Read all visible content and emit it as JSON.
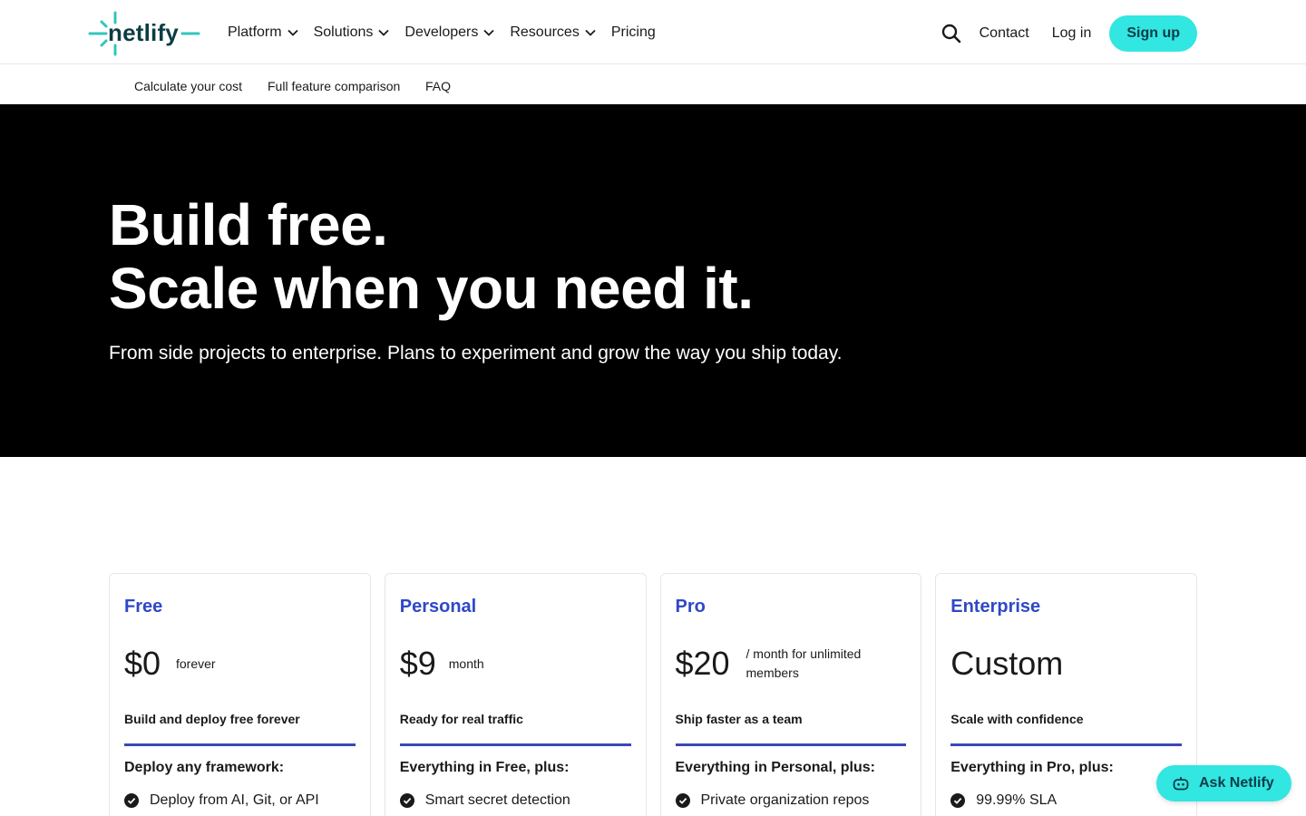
{
  "brand": {
    "logo_text": "netlify",
    "accent_color": "#32e6e2",
    "plan_color": "#2f48c8"
  },
  "nav": {
    "items": [
      {
        "label": "Platform",
        "has_dropdown": true
      },
      {
        "label": "Solutions",
        "has_dropdown": true
      },
      {
        "label": "Developers",
        "has_dropdown": true
      },
      {
        "label": "Resources",
        "has_dropdown": true
      },
      {
        "label": "Pricing",
        "has_dropdown": false
      }
    ],
    "search_icon": "search-icon",
    "contact": "Contact",
    "login": "Log in",
    "signup": "Sign up"
  },
  "subnav": {
    "items": [
      "Calculate your cost",
      "Full feature comparison",
      "FAQ"
    ]
  },
  "hero": {
    "line1": "Build free.",
    "line2": "Scale when you need it.",
    "subtitle": "From side projects to enterprise. Plans to experiment and grow the way you ship today."
  },
  "plans": [
    {
      "name": "Free",
      "price": "$0",
      "price_note": "forever",
      "tagline": "Build and deploy free forever",
      "features_heading": "Deploy any framework:",
      "first_feature": "Deploy from AI, Git, or API"
    },
    {
      "name": "Personal",
      "price": "$9",
      "price_note": "month",
      "tagline": "Ready for real traffic",
      "features_heading": "Everything in Free, plus:",
      "first_feature": "Smart secret detection"
    },
    {
      "name": "Pro",
      "price": "$20",
      "price_note": "/ month for unlimited members",
      "tagline": "Ship faster as a team",
      "features_heading": "Everything in Personal, plus:",
      "first_feature": "Private organization repos"
    },
    {
      "name": "Enterprise",
      "price": "Custom",
      "price_note": "",
      "tagline": "Scale with confidence",
      "features_heading": "Everything in Pro, plus:",
      "first_feature": "99.99% SLA"
    }
  ],
  "assistant": {
    "label": "Ask Netlify",
    "icon": "bot-icon"
  }
}
